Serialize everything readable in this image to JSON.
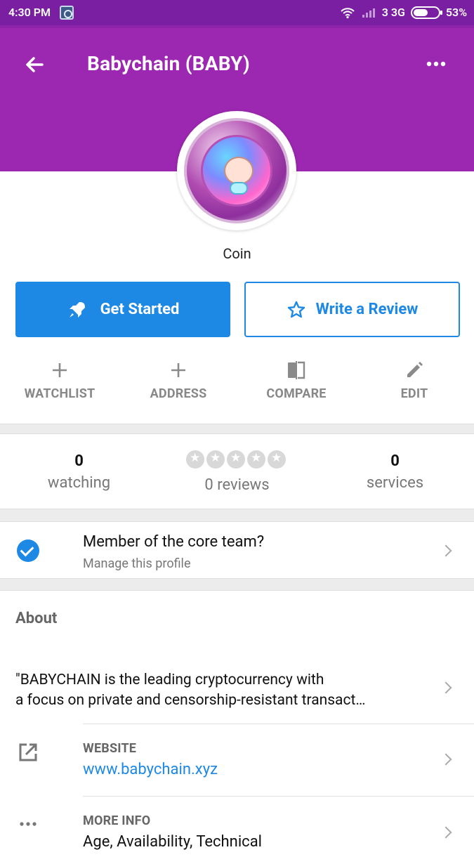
{
  "status": {
    "time": "4:30 PM",
    "network": "3 3G",
    "battery": "53%"
  },
  "header": {
    "title": "Babychain (BABY)"
  },
  "profile": {
    "type_label": "Coin"
  },
  "buttons": {
    "get_started": "Get Started",
    "write_review": "Write a Review"
  },
  "actions": [
    {
      "label": "WATCHLIST",
      "icon": "plus-icon"
    },
    {
      "label": "ADDRESS",
      "icon": "plus-icon"
    },
    {
      "label": "COMPARE",
      "icon": "compare-icon"
    },
    {
      "label": "EDIT",
      "icon": "pencil-icon"
    }
  ],
  "stats": {
    "watching_count": "0",
    "watching_label": "watching",
    "reviews_label": "0 reviews",
    "services_count": "0",
    "services_label": "services"
  },
  "core": {
    "title": "Member of the core team?",
    "subtitle": "Manage this profile"
  },
  "about": {
    "title": "About",
    "text_line1": "\"BABYCHAIN is the leading cryptocurrency with",
    "text_line2": "a focus on private and censorship-resistant transact…",
    "website_title": "WEBSITE",
    "website_value": "www.babychain.xyz",
    "more_info_title": "MORE INFO",
    "more_info_value": "Age, Availability, Technical"
  },
  "colors": {
    "purple": "#9c27b0",
    "blue": "#1e88e5"
  }
}
